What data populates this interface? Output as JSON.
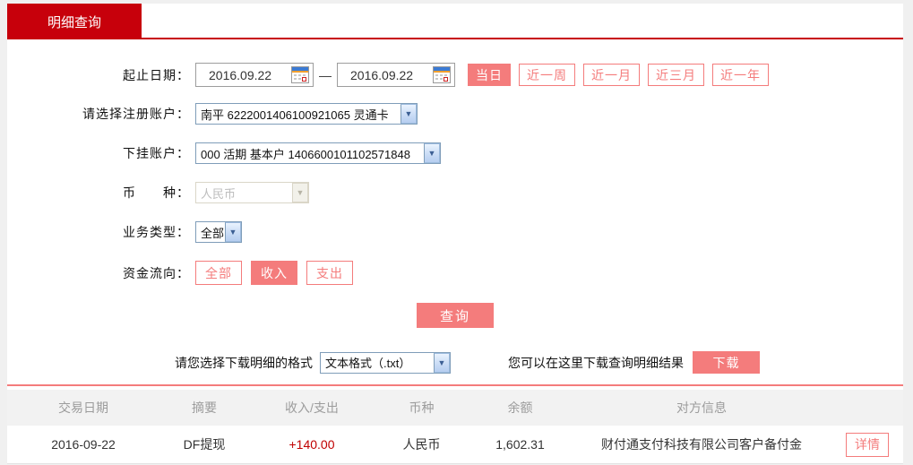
{
  "tab": {
    "label": "明细查询"
  },
  "form": {
    "date_range": {
      "label": "起止日期：",
      "start": "2016.09.22",
      "end": "2016.09.22",
      "separator": "—",
      "quick_buttons": [
        {
          "label": "当日",
          "active": true
        },
        {
          "label": "近一周",
          "active": false
        },
        {
          "label": "近一月",
          "active": false
        },
        {
          "label": "近三月",
          "active": false
        },
        {
          "label": "近一年",
          "active": false
        }
      ]
    },
    "registered_account": {
      "label": "请选择注册账户：",
      "value": "南平 6222001406100921065 灵通卡"
    },
    "sub_account": {
      "label": "下挂账户：",
      "value": "000 活期 基本户 1406600101102571848"
    },
    "currency": {
      "label": "币　　种：",
      "value": "人民币",
      "disabled": true
    },
    "business_type": {
      "label": "业务类型：",
      "value": "全部"
    },
    "fund_flow": {
      "label": "资金流向：",
      "options": [
        {
          "label": "全部",
          "active": false
        },
        {
          "label": "收入",
          "active": true
        },
        {
          "label": "支出",
          "active": false
        }
      ]
    },
    "query_button": "查询",
    "download": {
      "format_label": "请您选择下载明细的格式",
      "format_value": "文本格式（.txt）",
      "hint": "您可以在这里下载查询明细结果",
      "button": "下载"
    }
  },
  "table": {
    "headers": [
      "交易日期",
      "摘要",
      "收入/支出",
      "币种",
      "余额",
      "对方信息"
    ],
    "rows": [
      {
        "date": "2016-09-22",
        "summary": "DF提现",
        "amount": "+140.00",
        "currency": "人民币",
        "balance": "1,602.31",
        "counterparty": "财付通支付科技有限公司客户备付金",
        "detail_button": "详情"
      }
    ]
  },
  "colors": {
    "brand_red": "#c7000b",
    "salmon": "#f47c7c",
    "amount_red": "#c00000",
    "header_gray": "#9c9c9c"
  }
}
